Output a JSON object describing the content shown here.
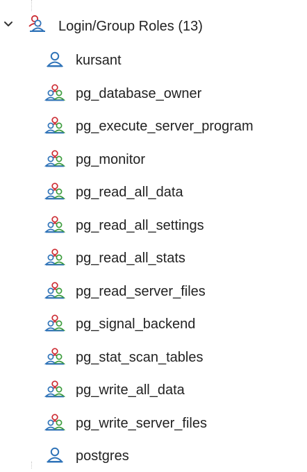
{
  "tree": {
    "group": {
      "label": "Login/Group Roles (13)",
      "icon": "group-roles-icon",
      "expanded": true
    },
    "items": [
      {
        "label": "kursant",
        "icon": "login-role-icon"
      },
      {
        "label": "pg_database_owner",
        "icon": "group-role-icon"
      },
      {
        "label": "pg_execute_server_program",
        "icon": "group-role-icon"
      },
      {
        "label": "pg_monitor",
        "icon": "group-role-icon"
      },
      {
        "label": "pg_read_all_data",
        "icon": "group-role-icon"
      },
      {
        "label": "pg_read_all_settings",
        "icon": "group-role-icon"
      },
      {
        "label": "pg_read_all_stats",
        "icon": "group-role-icon"
      },
      {
        "label": "pg_read_server_files",
        "icon": "group-role-icon"
      },
      {
        "label": "pg_signal_backend",
        "icon": "group-role-icon"
      },
      {
        "label": "pg_stat_scan_tables",
        "icon": "group-role-icon"
      },
      {
        "label": "pg_write_all_data",
        "icon": "group-role-icon"
      },
      {
        "label": "pg_write_server_files",
        "icon": "group-role-icon"
      },
      {
        "label": "postgres",
        "icon": "login-role-icon"
      }
    ]
  },
  "colors": {
    "text": "#222222",
    "login_blue": "#2f73b8",
    "group_red": "#cc2b32",
    "group_green": "#3c9c3c",
    "group_blue": "#2f73b8"
  }
}
